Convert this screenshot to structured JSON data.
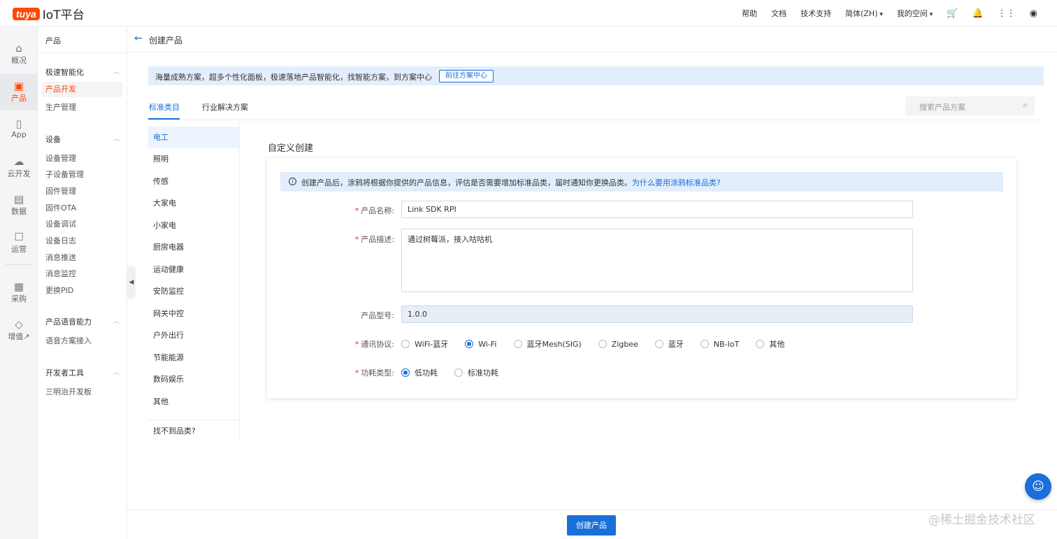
{
  "brand": {
    "logo_text": "tuya",
    "platform": "IoT平台"
  },
  "topnav": {
    "help": "帮助",
    "docs": "文档",
    "support": "技术支持",
    "language": "简体(ZH)",
    "space": "我的空间"
  },
  "rail": [
    {
      "label": "概况",
      "icon": "home-icon"
    },
    {
      "label": "产品",
      "icon": "product-icon"
    },
    {
      "label": "App",
      "icon": "phone-icon"
    },
    {
      "label": "云开发",
      "icon": "cloud-icon"
    },
    {
      "label": "数据",
      "icon": "chart-icon"
    },
    {
      "label": "运营",
      "icon": "operation-icon"
    },
    {
      "label": "采购",
      "icon": "store-icon"
    },
    {
      "label": "增值↗",
      "icon": "diamond-icon"
    }
  ],
  "subnav": {
    "head": "产品",
    "groups": [
      {
        "title": "极速智能化",
        "items": [
          "产品开发",
          "生产管理"
        ]
      },
      {
        "title": "设备",
        "items": [
          "设备管理",
          "子设备管理",
          "固件管理",
          "固件OTA",
          "设备调试",
          "设备日志",
          "消息推送",
          "消息监控",
          "更换PID"
        ]
      },
      {
        "title": "产品语音能力",
        "items": [
          "语音方案接入"
        ]
      },
      {
        "title": "开发者工具",
        "items": [
          "三明治开发板"
        ]
      }
    ]
  },
  "page": {
    "title": "创建产品"
  },
  "banner": {
    "text": "海量成熟方案，超多个性化面板，极速落地产品智能化，找智能方案，到方案中心",
    "button": "前往方案中心"
  },
  "tabs": [
    {
      "label": "标准类目"
    },
    {
      "label": "行业解决方案"
    }
  ],
  "search": {
    "placeholder": "搜索产品方案"
  },
  "categories": [
    "电工",
    "照明",
    "传感",
    "大家电",
    "小家电",
    "厨房电器",
    "运动健康",
    "安防监控",
    "网关中控",
    "户外出行",
    "节能能源",
    "数码娱乐",
    "其他"
  ],
  "categories_footer": "找不到品类?",
  "form": {
    "section_title": "自定义创建",
    "info_text": "创建产品后，涂鸦将根据你提供的产品信息，评估是否需要增加标准品类，届时通知你更换品类。",
    "info_link": "为什么要用涂鸦标准品类?",
    "name_label": "产品名称:",
    "name_value": "Link SDK RPI",
    "desc_label": "产品描述:",
    "desc_value": "通过树莓派，接入咕咕机",
    "model_label": "产品型号:",
    "model_value": "1.0.0",
    "protocol_label": "通讯协议:",
    "protocols": [
      {
        "label": "WiFi-蓝牙",
        "selected": false
      },
      {
        "label": "Wi-Fi",
        "selected": true
      },
      {
        "label": "蓝牙Mesh(SIG)",
        "selected": false
      },
      {
        "label": "Zigbee",
        "selected": false
      },
      {
        "label": "蓝牙",
        "selected": false
      },
      {
        "label": "NB-IoT",
        "selected": false
      },
      {
        "label": "其他",
        "selected": false
      }
    ],
    "power_label": "功耗类型:",
    "power_types": [
      {
        "label": "低功耗",
        "selected": true
      },
      {
        "label": "标准功耗",
        "selected": false
      }
    ]
  },
  "footer": {
    "create_button": "创建产品"
  },
  "watermark": "@稀土掘金技术社区"
}
